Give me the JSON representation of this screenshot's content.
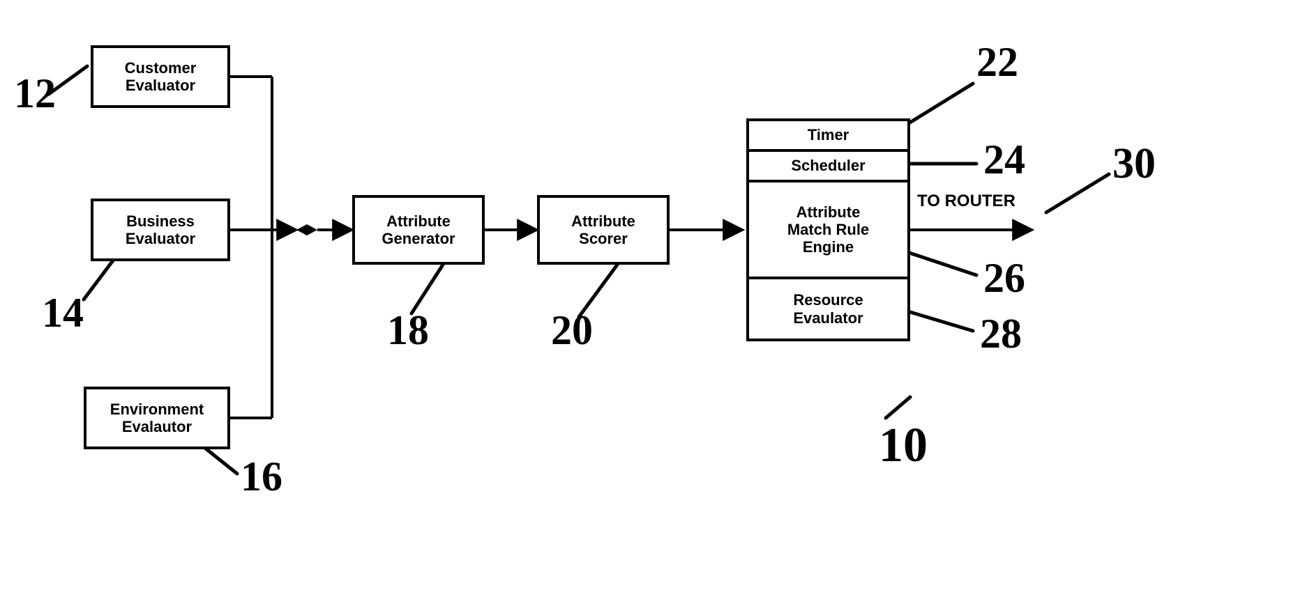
{
  "boxes": {
    "customer": "Customer\nEvaluator",
    "business": "Business\nEvaluator",
    "environment": "Environment\nEvalautor",
    "attr_gen": "Attribute\nGenerator",
    "attr_scorer": "Attribute\nScorer"
  },
  "stack": {
    "timer": "Timer",
    "scheduler": "Scheduler",
    "amre": "Attribute\nMatch Rule\nEngine",
    "resource": "Resource\nEvaulator"
  },
  "labels": {
    "n10": "10",
    "n12": "12",
    "n14": "14",
    "n16": "16",
    "n18": "18",
    "n20": "20",
    "n22": "22",
    "n24": "24",
    "n26": "26",
    "n28": "28",
    "n30": "30",
    "router": "TO ROUTER"
  }
}
